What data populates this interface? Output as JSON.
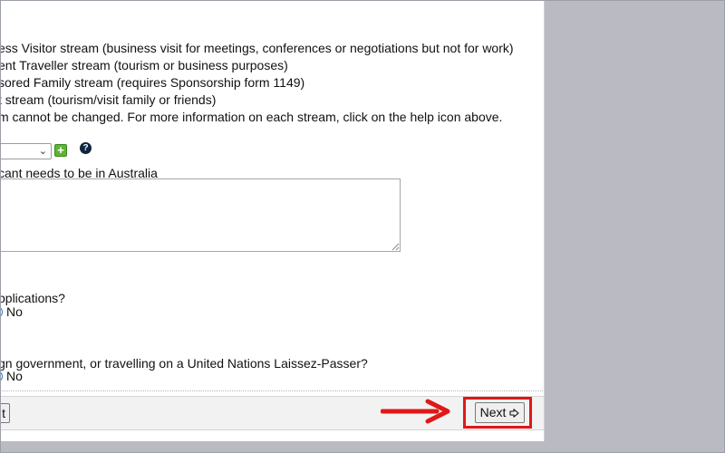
{
  "streams": {
    "line1": "ess Visitor stream (business visit for meetings, conferences or negotiations but not for work)",
    "line2": "ent Traveller stream (tourism or business purposes)",
    "line3": "sored Family stream (requires Sponsorship form 1149)",
    "line4": "t stream (tourism/visit family or friends)",
    "note": "m cannot be changed. For more information on each stream, click on the help icon above."
  },
  "stream_select": {
    "chevron": "⌄",
    "add_icon": "plus-square-icon",
    "add_label": "+",
    "help_icon": "question-circle-icon",
    "help_label": "?"
  },
  "reason": {
    "label": "cant needs to be in Australia",
    "value": ""
  },
  "question1": {
    "text": "pplications?",
    "option_label": "No"
  },
  "question2": {
    "text": "gn government, or travelling on a United Nations Laissez-Passer?",
    "option_label": "No"
  },
  "footer": {
    "previous_label": "t",
    "next_label": "Next",
    "next_icon": "arrow-right-outline-icon"
  },
  "colors": {
    "highlight": "#e01818",
    "gutter": "#babbc2",
    "add_green": "#5fb336",
    "help_navy": "#0f2540"
  }
}
